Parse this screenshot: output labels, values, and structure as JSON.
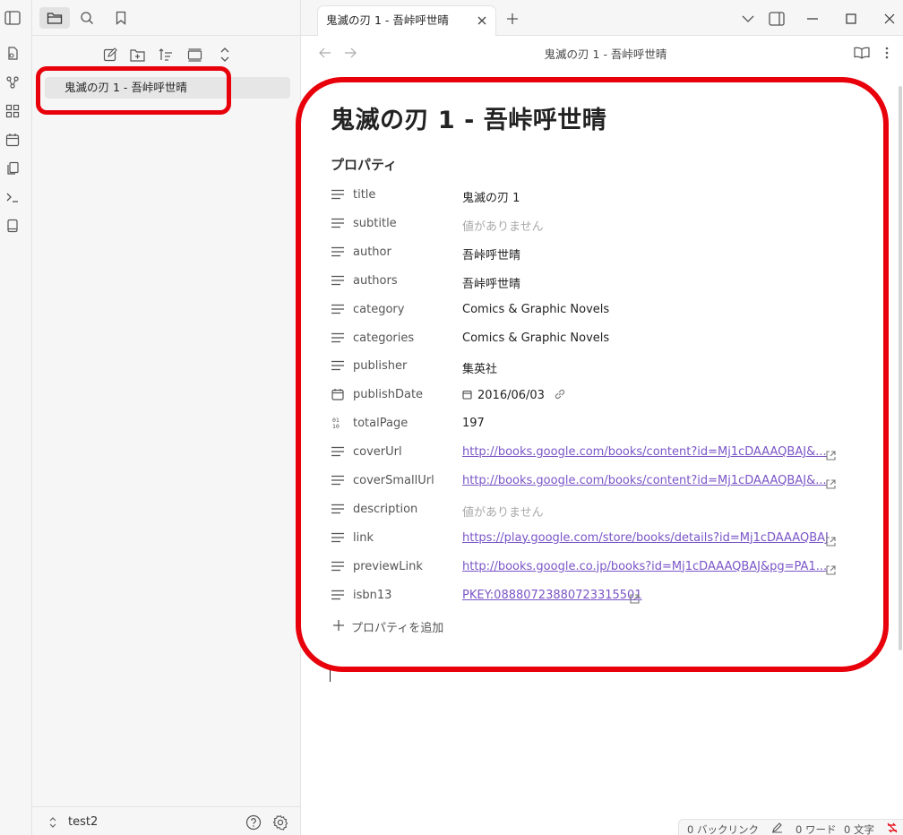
{
  "colors": {
    "accent": "#7a55c7",
    "highlight": "#e8000b",
    "sidebar_bg": "#f6f6f6"
  },
  "ribbon": {
    "icons": [
      "open-quick-switcher-icon",
      "graph-view-icon",
      "canvas-icon",
      "daily-note-icon",
      "templates-icon",
      "command-palette-icon",
      "book-icon"
    ]
  },
  "sidebar": {
    "file_item": "鬼滅の刃 1 - 吾峠呼世晴",
    "vault_name": "test2"
  },
  "tab": {
    "title": "鬼滅の刃 1 - 吾峠呼世晴"
  },
  "view": {
    "header_title": "鬼滅の刃 1 - 吾峠呼世晴"
  },
  "note": {
    "title": "鬼滅の刃 1 - 吾峠呼世晴",
    "properties_heading": "プロパティ",
    "add_property": "プロパティを追加",
    "properties": [
      {
        "key": "title",
        "value": "鬼滅の刃 1",
        "type": "text",
        "icon": "text-lines-icon"
      },
      {
        "key": "subtitle",
        "value": "値がありません",
        "type": "empty",
        "icon": "text-lines-icon"
      },
      {
        "key": "author",
        "value": "吾峠呼世晴",
        "type": "text",
        "icon": "text-lines-icon"
      },
      {
        "key": "authors",
        "value": "吾峠呼世晴",
        "type": "text",
        "icon": "text-lines-icon"
      },
      {
        "key": "category",
        "value": "Comics & Graphic Novels",
        "type": "text",
        "icon": "text-lines-icon"
      },
      {
        "key": "categories",
        "value": "Comics & Graphic Novels",
        "type": "text",
        "icon": "text-lines-icon"
      },
      {
        "key": "publisher",
        "value": "集英社",
        "type": "text",
        "icon": "text-lines-icon"
      },
      {
        "key": "publishDate",
        "value": "2016/06/03",
        "type": "date",
        "icon": "calendar-icon"
      },
      {
        "key": "totalPage",
        "value": "197",
        "type": "number",
        "icon": "number-icon"
      },
      {
        "key": "coverUrl",
        "value": "http://books.google.com/books/content?id=Mj1cDAAAQBAJ&...",
        "type": "link",
        "icon": "text-lines-icon"
      },
      {
        "key": "coverSmallUrl",
        "value": "http://books.google.com/books/content?id=Mj1cDAAAQBAJ&...",
        "type": "link",
        "icon": "text-lines-icon"
      },
      {
        "key": "description",
        "value": "値がありません",
        "type": "empty",
        "icon": "text-lines-icon"
      },
      {
        "key": "link",
        "value": "https://play.google.com/store/books/details?id=Mj1cDAAAQBAJ",
        "type": "link",
        "icon": "text-lines-icon"
      },
      {
        "key": "previewLink",
        "value": "http://books.google.co.jp/books?id=Mj1cDAAAQBAJ&pg=PA1...",
        "type": "link",
        "icon": "text-lines-icon"
      },
      {
        "key": "isbn13",
        "value": "PKEY:08880723880723315501",
        "type": "link",
        "icon": "text-lines-icon"
      }
    ]
  },
  "status": {
    "backlinks": "0 バックリンク",
    "words": "0 ワード",
    "chars": "0 文字"
  }
}
